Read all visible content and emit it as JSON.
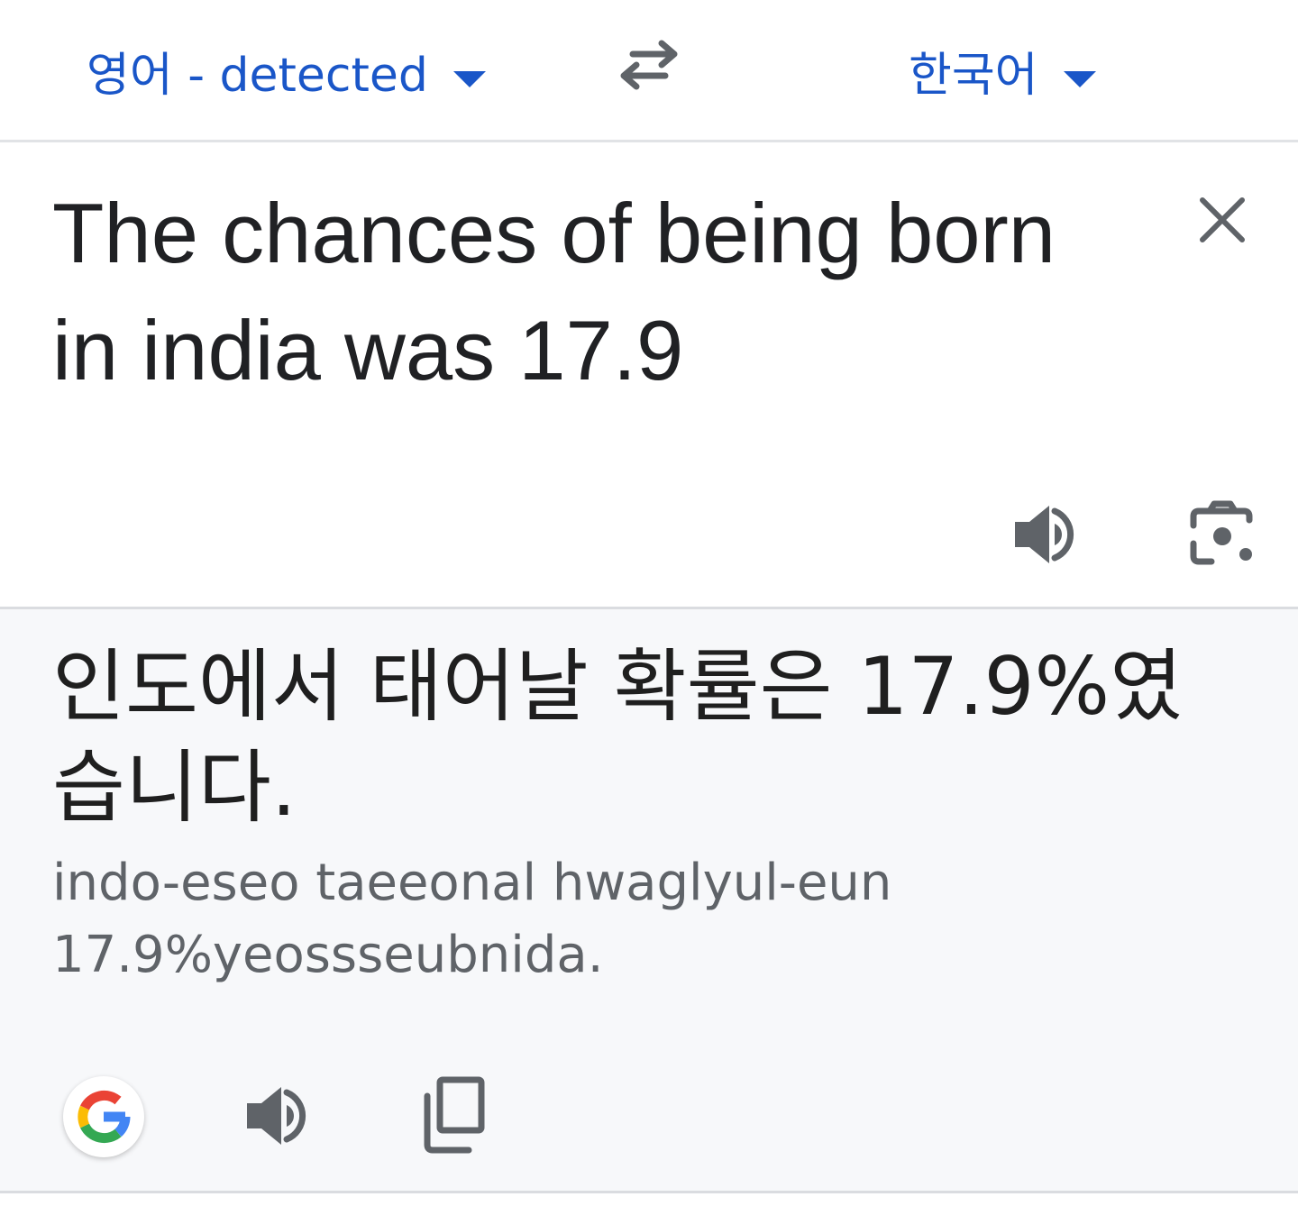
{
  "language_bar": {
    "source_language": "영어 - detected",
    "target_language": "한국어",
    "swap_icon": "swap-arrows-icon"
  },
  "source": {
    "text": "The chances of being born in india was 17.9",
    "clear_icon": "close-icon",
    "speaker_icon": "speaker-icon",
    "camera_icon": "camera-lens-icon"
  },
  "result": {
    "translation": "인도에서 태어날 확률은 17.9%였습니다.",
    "romanization": "indo-eseo taeeonal hwaglyul-eun 17.9%yeossseubnida.",
    "google_icon": "google-g-icon",
    "speaker_icon": "speaker-icon",
    "copy_icon": "copy-icon"
  },
  "colors": {
    "accent": "#1a56c8",
    "text_primary": "#202124",
    "text_secondary": "#5f6368",
    "icon_gray": "#5f6368",
    "result_background": "#f7f8fa",
    "divider": "#dadce0"
  }
}
